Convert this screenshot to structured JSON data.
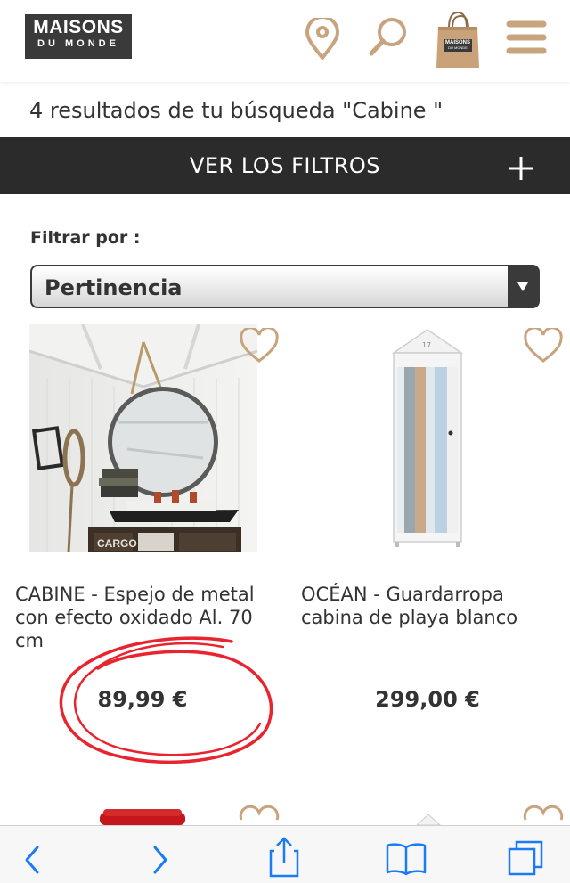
{
  "brand": {
    "line1": "MAISONS",
    "line2": "DU MONDE"
  },
  "header_icons": [
    "location-pin-icon",
    "search-icon",
    "shopping-bag-icon",
    "menu-icon"
  ],
  "bag_label": {
    "line1": "MAISONS",
    "line2": "DU MONDE"
  },
  "results_text": "4 resultados de tu búsqueda \"Cabine \"",
  "filter_bar": {
    "label": "VER LOS FILTROS",
    "icon": "plus-icon"
  },
  "filter": {
    "label": "Filtrar por :",
    "selected": "Pertinencia"
  },
  "products": [
    {
      "name": "CABINE - Espejo de metal con efecto oxidado Al. 70 cm",
      "price": "89,99 €",
      "image_text": "CARGO",
      "favorite_icon": "heart-icon"
    },
    {
      "name": "OCÉAN - Guardarropa cabina de playa blanco",
      "price": "299,00 €",
      "image_text": "17",
      "favorite_icon": "heart-icon"
    }
  ],
  "annotation": {
    "color": "#e8242f",
    "shape": "hand-drawn-circle"
  },
  "colors": {
    "accent": "#c8a47e",
    "dark": "#2b2b2b",
    "ios_blue": "#1a7cf5"
  },
  "toolbar_icons": [
    "back-icon",
    "forward-icon",
    "share-icon",
    "bookmarks-icon",
    "tabs-icon"
  ]
}
